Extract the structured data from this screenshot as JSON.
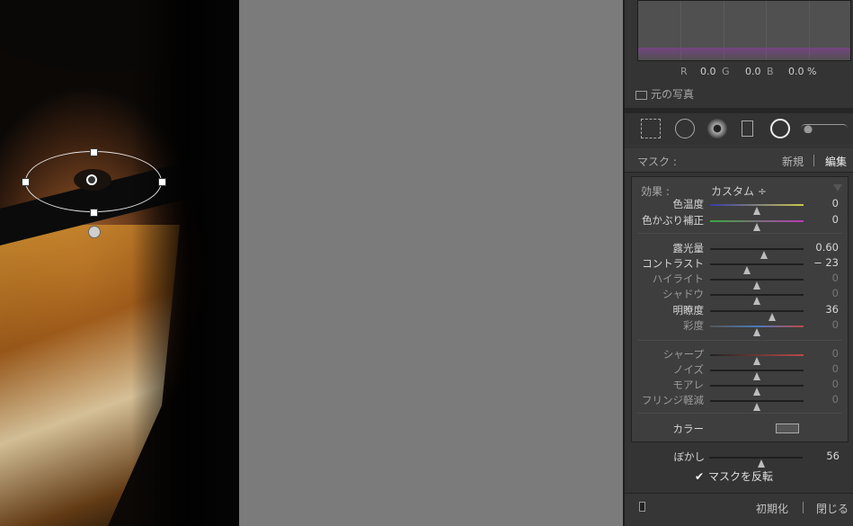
{
  "histogram": {
    "r_label": "R",
    "r_value": "0.0",
    "g_label": "G",
    "g_value": "0.0",
    "b_label": "B",
    "b_value": "0.0 %"
  },
  "original_photo_label": "元の写真",
  "tools": [
    "crop-overlay-icon",
    "spot-removal-icon",
    "red-eye-icon",
    "graduated-filter-icon",
    "radial-filter-icon",
    "adjustment-brush-icon"
  ],
  "mask": {
    "label": "マスク :",
    "new_label": "新規",
    "edit_label": "編集"
  },
  "effect": {
    "label": "効果 :",
    "preset": "カスタム ÷"
  },
  "groups": [
    [
      {
        "name": "色温度",
        "value": "0",
        "pos": 0.5,
        "dim": false
      },
      {
        "name": "色かぶり補正",
        "value": "0",
        "pos": 0.5,
        "dim": false
      }
    ],
    [
      {
        "name": "露光量",
        "value": "0.60",
        "pos": 0.58,
        "dim": false
      },
      {
        "name": "コントラスト",
        "value": "− 23",
        "pos": 0.39,
        "dim": false
      },
      {
        "name": "ハイライト",
        "value": "0",
        "pos": 0.5,
        "dim": true
      },
      {
        "name": "シャドウ",
        "value": "0",
        "pos": 0.5,
        "dim": true
      },
      {
        "name": "明瞭度",
        "value": "36",
        "pos": 0.66,
        "dim": false
      },
      {
        "name": "彩度",
        "value": "0",
        "pos": 0.5,
        "dim": true
      }
    ],
    [
      {
        "name": "シャープ",
        "value": "0",
        "pos": 0.5,
        "dim": true
      },
      {
        "name": "ノイズ",
        "value": "0",
        "pos": 0.5,
        "dim": true
      },
      {
        "name": "モアレ",
        "value": "0",
        "pos": 0.5,
        "dim": true
      },
      {
        "name": "フリンジ軽減",
        "value": "0",
        "pos": 0.5,
        "dim": true
      }
    ]
  ],
  "color_label": "カラー",
  "feather": {
    "name": "ぼかし",
    "value": "56",
    "pos": 0.56
  },
  "invert_label": "マスクを反転",
  "footer": {
    "reset": "初期化",
    "close": "閉じる"
  }
}
